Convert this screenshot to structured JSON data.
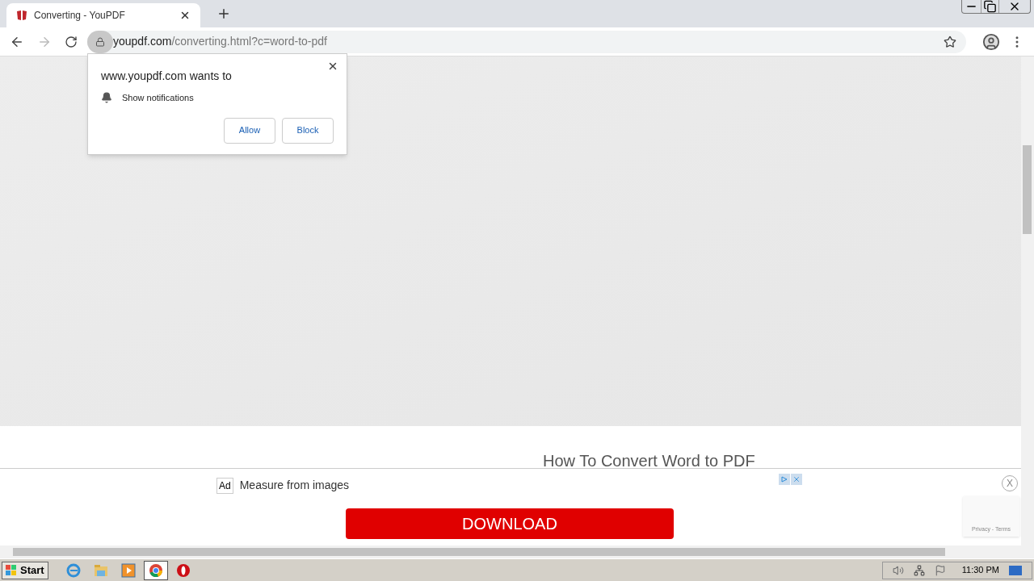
{
  "tab": {
    "title": "Converting - YouPDF",
    "selected": true
  },
  "address": {
    "host": "youpdf.com",
    "path": "/converting.html?c=word-to-pdf"
  },
  "permission_popup": {
    "title": "www.youpdf.com wants to",
    "request": "Show notifications",
    "buttons": [
      "Allow",
      "Block"
    ]
  },
  "page": {
    "heading": "How To Convert Word to PDF",
    "recaptcha": "Privacy - Terms"
  },
  "ad": {
    "badge": "Ad",
    "text": "Measure from images",
    "button": "DOWNLOAD",
    "close": "X"
  },
  "taskbar": {
    "start": "Start",
    "apps": [
      {
        "kind": "ie",
        "selected": false
      },
      {
        "kind": "explorer",
        "selected": false
      },
      {
        "kind": "media",
        "selected": false
      },
      {
        "kind": "chrome",
        "selected": true
      },
      {
        "kind": "opera",
        "selected": false
      }
    ],
    "clock": "11:30 PM"
  }
}
